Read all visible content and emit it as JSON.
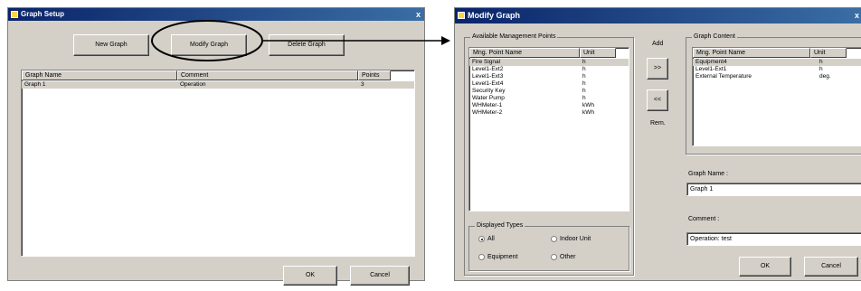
{
  "graph_setup": {
    "title": "Graph Setup",
    "close_glyph": "x",
    "buttons": {
      "new": "New Graph",
      "modify": "Modify Graph",
      "delete": "Delete Graph",
      "ok": "OK",
      "cancel": "Cancel"
    },
    "columns": {
      "name": "Graph Name",
      "comment": "Comment",
      "points": "Points"
    },
    "rows": [
      {
        "name": "Graph 1",
        "comment": "Operation",
        "points": "3"
      }
    ]
  },
  "modify_graph": {
    "title": "Modify Graph",
    "close_glyph": "x",
    "available_group_label": "Available Management Points",
    "columns": {
      "name": "Mng. Point Name",
      "unit": "Unit"
    },
    "available_points": [
      {
        "name": "Fire Signal",
        "unit": "h"
      },
      {
        "name": "Level1-Ext2",
        "unit": "h"
      },
      {
        "name": "Level1-Ext3",
        "unit": "h"
      },
      {
        "name": "Level1-Ext4",
        "unit": "h"
      },
      {
        "name": "Security Key",
        "unit": "h"
      },
      {
        "name": "Water Pump",
        "unit": "h"
      },
      {
        "name": "WHMeter-1",
        "unit": "kWh"
      },
      {
        "name": "WHMeter-2",
        "unit": "kWh"
      }
    ],
    "add_label": "Add",
    "rem_label": "Rem.",
    "add_button": ">>",
    "rem_button": "<<",
    "content_group_label": "Graph Content",
    "content_points": [
      {
        "name": "Equipment4",
        "unit": "h"
      },
      {
        "name": "Level1-Ext1",
        "unit": "h"
      },
      {
        "name": "External Temperature",
        "unit": "deg."
      }
    ],
    "displayed_types_label": "Displayed Types",
    "types": {
      "all": "All",
      "indoor": "Indoor Unit",
      "equipment": "Equipment",
      "other": "Other"
    },
    "graph_name_label": "Graph Name :",
    "graph_name_value": "Graph 1",
    "comment_label": "Comment :",
    "comment_value": "Operation: test",
    "ok": "OK",
    "cancel": "Cancel"
  }
}
